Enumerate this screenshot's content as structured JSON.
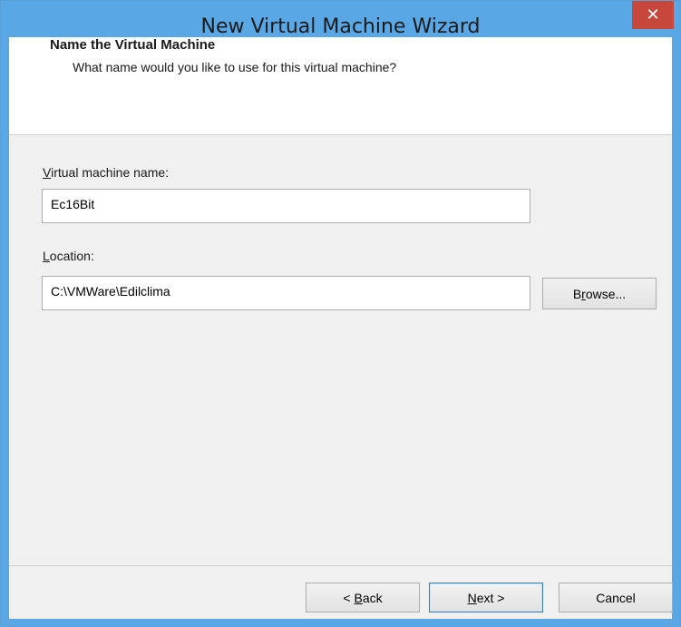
{
  "window": {
    "title": "New Virtual Machine Wizard",
    "close_glyph": "✕"
  },
  "header": {
    "title": "Name the Virtual Machine",
    "subtitle": "What name would you like to use for this virtual machine?"
  },
  "form": {
    "name_label_mnemonic": "V",
    "name_label_rest": "irtual machine name:",
    "name_value": "Ec16Bit",
    "location_label_mnemonic": "L",
    "location_label_rest": "ocation:",
    "location_value": "C:\\VMWare\\Edilclima",
    "browse_label_mnemonic": "r",
    "browse_label_pre": "B",
    "browse_label_post": "owse..."
  },
  "footer": {
    "back_pre": "< ",
    "back_mnemonic": "B",
    "back_post": "ack",
    "next_mnemonic": "N",
    "next_post": "ext >",
    "cancel_label": "Cancel"
  },
  "colors": {
    "accent": "#59a8e5",
    "close": "#c7473b"
  }
}
